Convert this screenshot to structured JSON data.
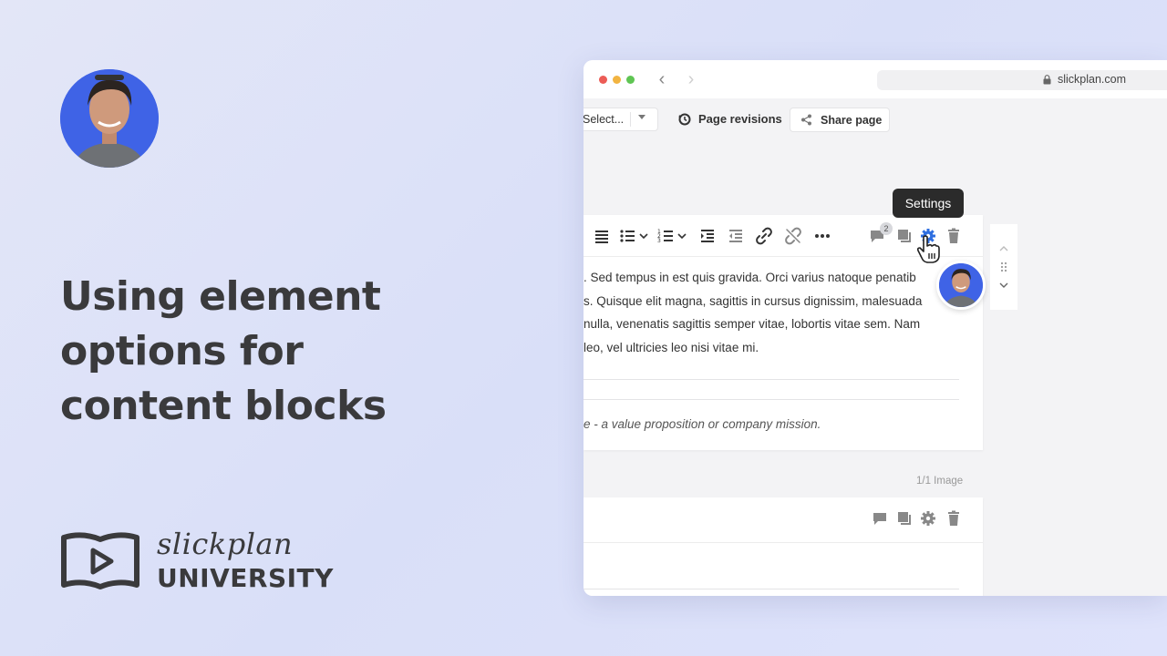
{
  "headline": {
    "line1": "Using element",
    "line2": "options for",
    "line3": "content blocks"
  },
  "brand": {
    "script": "slickplan",
    "university": "UNIVERSITY"
  },
  "browser": {
    "url": "slickplan.com"
  },
  "page_toolbar": {
    "select_value": "Select...",
    "revisions_label": "Page revisions",
    "share_label": "Share page"
  },
  "tooltip": {
    "text": "Settings"
  },
  "editor": {
    "comment_count": "2",
    "paragraph_lines": [
      ". Sed tempus in est quis gravida. Orci varius natoque penatib",
      "s. Quisque elit magna, sagittis in cursus dignissim, malesuada",
      " nulla, venenatis sagittis semper vitae, lobortis vitae sem. Nam",
      " leo, vel ultricies leo nisi vitae mi."
    ],
    "tagline": "e - a value proposition or company mission."
  },
  "image_block": {
    "count_label": "1/1 Image"
  },
  "colors": {
    "accent": "#3f63e6",
    "settings_active": "#2f6fe0",
    "tooltip_bg": "#2b2b2b"
  }
}
